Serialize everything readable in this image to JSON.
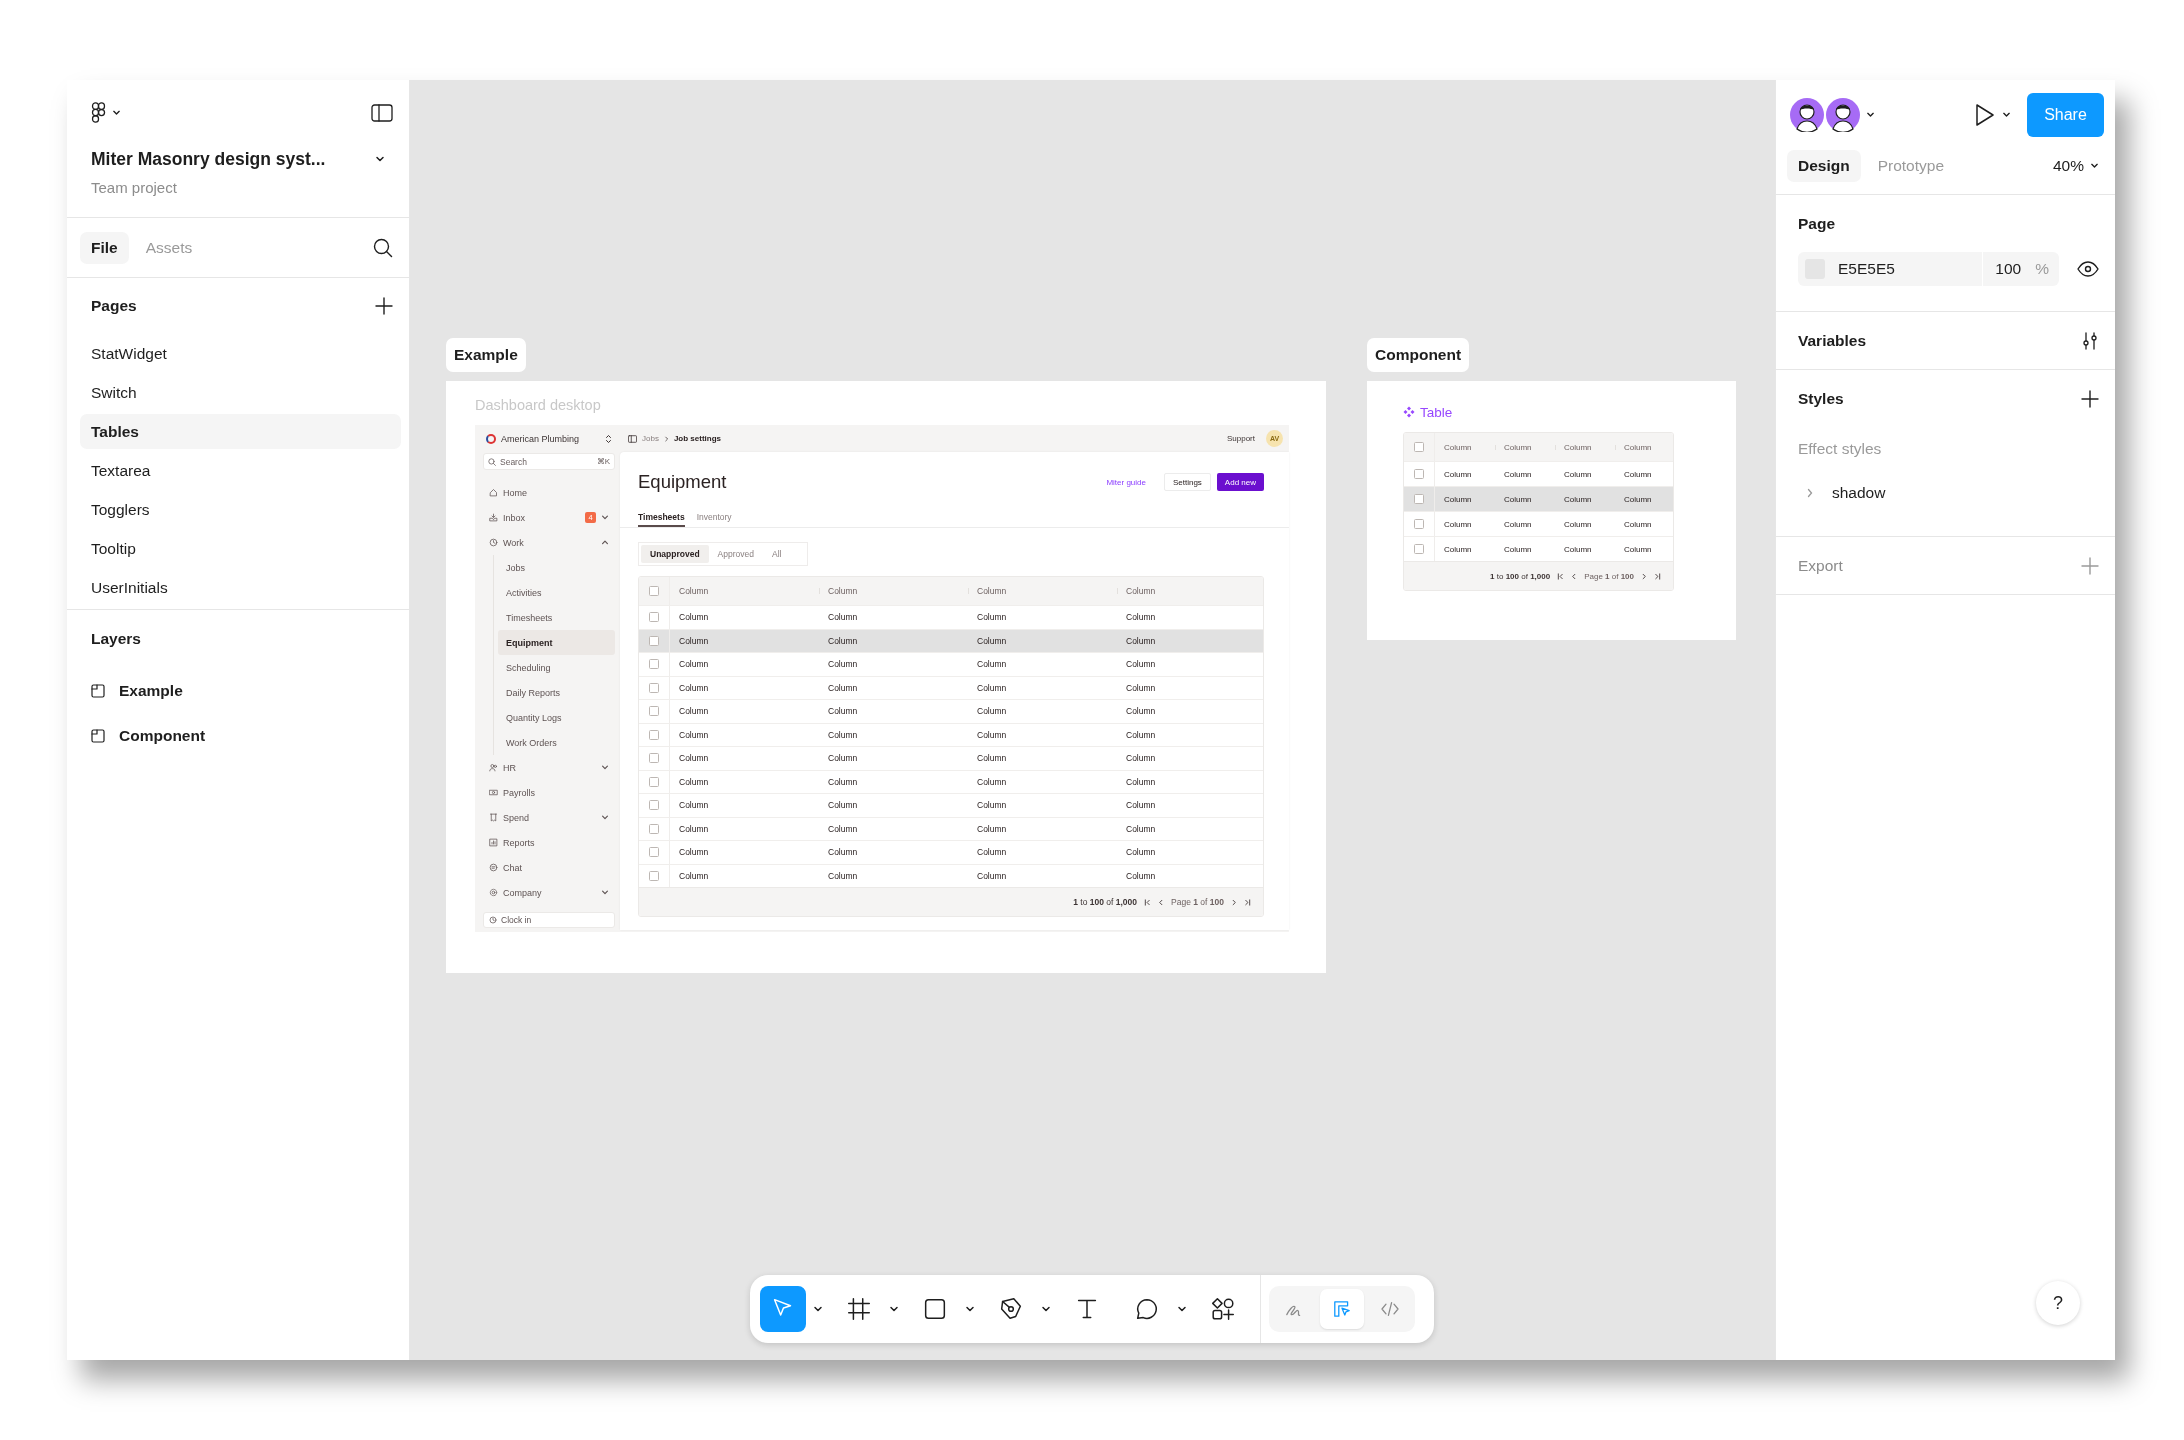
{
  "file": {
    "title": "Miter Masonry design syst...",
    "subtitle": "Team project"
  },
  "left_tabs": [
    {
      "label": "File",
      "selected": true
    },
    {
      "label": "Assets",
      "selected": false
    }
  ],
  "pages": {
    "title": "Pages",
    "items": [
      {
        "label": "StatWidget",
        "selected": false
      },
      {
        "label": "Switch",
        "selected": false
      },
      {
        "label": "Tables",
        "selected": true
      },
      {
        "label": "Textarea",
        "selected": false
      },
      {
        "label": "Togglers",
        "selected": false
      },
      {
        "label": "Tooltip",
        "selected": false
      },
      {
        "label": "UserInitials",
        "selected": false
      }
    ]
  },
  "layers": {
    "title": "Layers",
    "items": [
      {
        "label": "Example",
        "selected": false
      },
      {
        "label": "Component",
        "selected": false
      }
    ]
  },
  "example": {
    "label": "Example",
    "caption": "Dashboard desktop",
    "dashboard": {
      "workspace": "American Plumbing",
      "search": {
        "placeholder": "Search",
        "shortcut": "⌘K"
      },
      "nav": [
        {
          "label": "Home",
          "selected": false
        },
        {
          "label": "Inbox",
          "selected": false,
          "badge": "4",
          "expanded": false
        },
        {
          "label": "Work",
          "selected": false,
          "expanded": true,
          "children": [
            {
              "label": "Jobs",
              "selected": false
            },
            {
              "label": "Activities",
              "selected": false
            },
            {
              "label": "Timesheets",
              "selected": false
            },
            {
              "label": "Equipment",
              "selected": true
            },
            {
              "label": "Scheduling",
              "selected": false
            },
            {
              "label": "Daily Reports",
              "selected": false
            },
            {
              "label": "Quantity Logs",
              "selected": false
            },
            {
              "label": "Work Orders",
              "selected": false
            }
          ]
        },
        {
          "label": "HR",
          "selected": false,
          "expanded": false
        },
        {
          "label": "Payrolls",
          "selected": false
        },
        {
          "label": "Spend",
          "selected": false,
          "expanded": false
        },
        {
          "label": "Reports",
          "selected": false
        },
        {
          "label": "Chat",
          "selected": false
        },
        {
          "label": "Company",
          "selected": false,
          "expanded": false
        }
      ],
      "clock_in": "Clock in",
      "breadcrumb": [
        "Jobs",
        "Job settings"
      ],
      "support": "Support",
      "user_initials": "AV",
      "title": "Equipment",
      "link": "Miter guide",
      "buttons": [
        {
          "label": "Settings",
          "kind": "secondary"
        },
        {
          "label": "Add new",
          "kind": "primary"
        }
      ],
      "tabs": [
        {
          "label": "Timesheets",
          "selected": true
        },
        {
          "label": "Inventory",
          "selected": false
        }
      ],
      "filters": [
        {
          "label": "Unapproved",
          "selected": true
        },
        {
          "label": "Approved",
          "selected": false
        },
        {
          "label": "All",
          "selected": false
        }
      ],
      "table": {
        "header_checked": false,
        "columns": [
          "Column",
          "Column",
          "Column",
          "Column"
        ],
        "rows": [
          {
            "cells": [
              "Column",
              "Column",
              "Column",
              "Column"
            ],
            "checked": false,
            "hovered": false
          },
          {
            "cells": [
              "Column",
              "Column",
              "Column",
              "Column"
            ],
            "checked": false,
            "hovered": true
          },
          {
            "cells": [
              "Column",
              "Column",
              "Column",
              "Column"
            ],
            "checked": false,
            "hovered": false
          },
          {
            "cells": [
              "Column",
              "Column",
              "Column",
              "Column"
            ],
            "checked": false,
            "hovered": false
          },
          {
            "cells": [
              "Column",
              "Column",
              "Column",
              "Column"
            ],
            "checked": false,
            "hovered": false
          },
          {
            "cells": [
              "Column",
              "Column",
              "Column",
              "Column"
            ],
            "checked": false,
            "hovered": false
          },
          {
            "cells": [
              "Column",
              "Column",
              "Column",
              "Column"
            ],
            "checked": false,
            "hovered": false
          },
          {
            "cells": [
              "Column",
              "Column",
              "Column",
              "Column"
            ],
            "checked": false,
            "hovered": false
          },
          {
            "cells": [
              "Column",
              "Column",
              "Column",
              "Column"
            ],
            "checked": false,
            "hovered": false
          },
          {
            "cells": [
              "Column",
              "Column",
              "Column",
              "Column"
            ],
            "checked": false,
            "hovered": false
          },
          {
            "cells": [
              "Column",
              "Column",
              "Column",
              "Column"
            ],
            "checked": false,
            "hovered": false
          },
          {
            "cells": [
              "Column",
              "Column",
              "Column",
              "Column"
            ],
            "checked": false,
            "hovered": false
          }
        ],
        "range": "**1** to **100** of **1,000**",
        "page": "Page **1** of **100**"
      }
    }
  },
  "component": {
    "label": "Component",
    "title": "Table",
    "table": {
      "header_checked": false,
      "columns": [
        "Column",
        "Column",
        "Column",
        "Column"
      ],
      "rows": [
        {
          "cells": [
            "Column",
            "Column",
            "Column",
            "Column"
          ],
          "checked": false,
          "hovered": false
        },
        {
          "cells": [
            "Column",
            "Column",
            "Column",
            "Column"
          ],
          "checked": false,
          "hovered": true
        },
        {
          "cells": [
            "Column",
            "Column",
            "Column",
            "Column"
          ],
          "checked": false,
          "hovered": false
        },
        {
          "cells": [
            "Column",
            "Column",
            "Column",
            "Column"
          ],
          "checked": false,
          "hovered": false
        }
      ],
      "range": "**1** to **100** of **1,000**",
      "page": "Page **1** of **100**"
    }
  },
  "toolbar": {
    "tools": [
      {
        "kind": "move",
        "selected": true
      },
      {
        "kind": "frame",
        "selected": false
      },
      {
        "kind": "shape",
        "selected": false
      },
      {
        "kind": "pen",
        "selected": false
      },
      {
        "kind": "text",
        "selected": false
      },
      {
        "kind": "comment",
        "selected": false
      },
      {
        "kind": "actions",
        "selected": false
      }
    ],
    "modes": [
      {
        "kind": "draw",
        "selected": false
      },
      {
        "kind": "design",
        "selected": true
      },
      {
        "kind": "dev",
        "selected": false
      }
    ]
  },
  "help": "?",
  "right_panel": {
    "share": "Share",
    "tabs": [
      {
        "label": "Design",
        "selected": true
      },
      {
        "label": "Prototype",
        "selected": false
      }
    ],
    "zoom": "40%",
    "page": {
      "title": "Page",
      "color": "E5E5E5",
      "opacity": "100",
      "unit": "%",
      "visible": true
    },
    "variables": {
      "title": "Variables"
    },
    "styles": {
      "title": "Styles",
      "group": "Effect styles",
      "items": [
        {
          "label": "shadow",
          "expanded": false
        }
      ]
    },
    "export": {
      "title": "Export"
    }
  }
}
